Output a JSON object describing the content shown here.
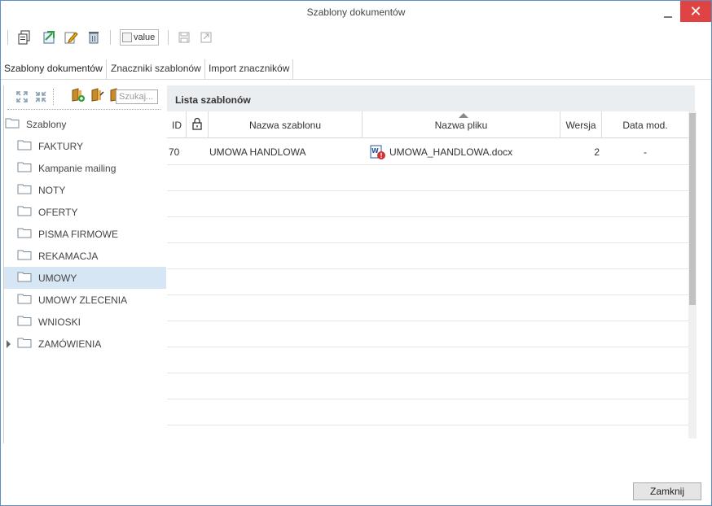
{
  "window": {
    "title": "Szablony dokumentów",
    "close_glyph": "✕"
  },
  "toolbar": {
    "image_alt": "value",
    "icons": [
      "copy-icon",
      "export-icon",
      "edit-icon",
      "delete-icon",
      "save-icon",
      "undo-icon"
    ]
  },
  "tabs": [
    {
      "label": "Szablony dokumentów"
    },
    {
      "label": "Znaczniki szablonów"
    },
    {
      "label": "Import znaczników"
    }
  ],
  "tree": {
    "search_placeholder": "Szukaj...",
    "root": "Szablony",
    "items": [
      {
        "label": "FAKTURY"
      },
      {
        "label": "Kampanie mailing"
      },
      {
        "label": "NOTY"
      },
      {
        "label": "OFERTY"
      },
      {
        "label": "PISMA FIRMOWE"
      },
      {
        "label": "REKAMACJA"
      },
      {
        "label": "UMOWY"
      },
      {
        "label": "UMOWY ZLECENIA"
      },
      {
        "label": "WNIOSKI"
      },
      {
        "label": "ZAMÓWIENIA"
      }
    ],
    "selected": "UMOWY"
  },
  "list": {
    "title": "Lista szablonów",
    "columns": {
      "id": "ID",
      "name": "Nazwa szablonu",
      "file": "Nazwa pliku",
      "version": "Wersja",
      "date": "Data mod."
    },
    "rows": [
      {
        "id": "70",
        "name": "UMOWA HANDLOWA",
        "file": "UMOWA_HANDLOWA.docx",
        "version": "2",
        "date": "-"
      }
    ]
  },
  "footer": {
    "close_label": "Zamknij"
  },
  "colors": {
    "accent": "#5b8fc7",
    "close_red": "#e04343",
    "selection": "#d7e6f4"
  }
}
